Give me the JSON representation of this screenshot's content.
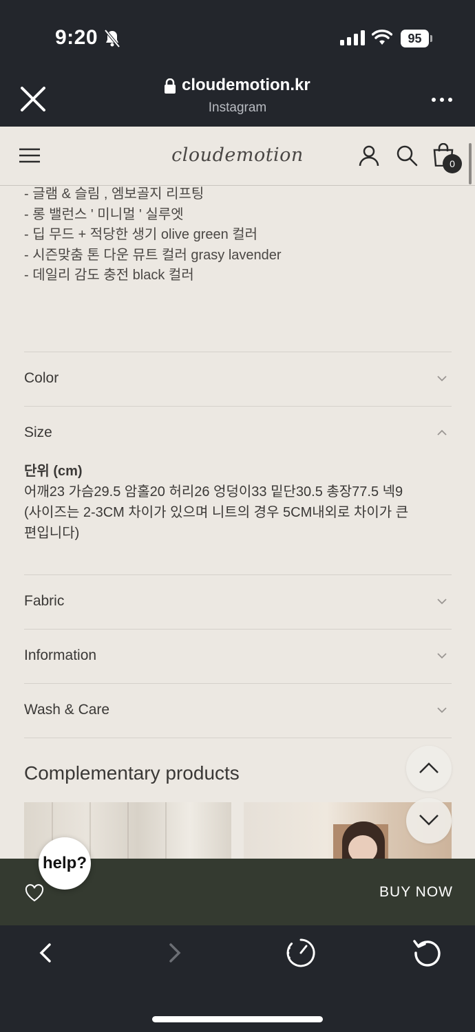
{
  "status_bar": {
    "time": "9:20",
    "battery": "95"
  },
  "browser": {
    "domain": "cloudemotion.kr",
    "source": "Instagram"
  },
  "site": {
    "logo": "cloudemotion",
    "cart_count": "0"
  },
  "description_lines": [
    "- 글램 & 슬림 , 엠보골지 리프팅",
    "- 롱 밸런스 ' 미니멀 ' 실루엣",
    "- 딥 무드 + 적당한 생기 olive green 컬러",
    "- 시즌맞춤 톤 다운 뮤트 컬러 grasy lavender",
    "- 데일리 감도 충전 black 컬러"
  ],
  "accordion": {
    "color": "Color",
    "size": "Size",
    "fabric": "Fabric",
    "information": "Information",
    "wash_care": "Wash & Care"
  },
  "size_details": {
    "unit": "단위 (cm)",
    "measurements": "어깨23 가슴29.5 암홀20 허리26 엉덩이33 밑단30.5 총장77.5 넥9",
    "note_line1": "(사이즈는 2-3CM 차이가 있으며 니트의 경우 5CM내외로 차이가 큰",
    "note_line2": "편입니다)"
  },
  "complementary": {
    "title": "Complementary products"
  },
  "buy_bar": {
    "buy_now": "BUY NOW",
    "help": "help?"
  },
  "colors": {
    "buy_bar_bg": "#343a30",
    "page_bg": "#ece8e2",
    "chrome_bg": "#23262c"
  }
}
